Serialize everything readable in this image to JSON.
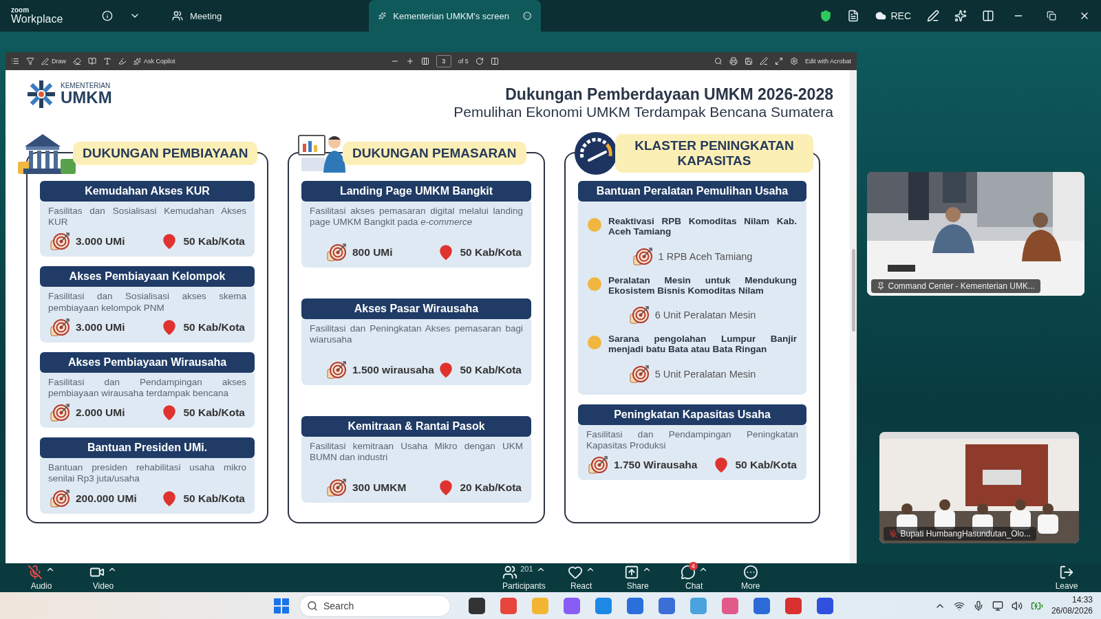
{
  "window": {
    "brand_top": "zoom",
    "brand": "Workplace",
    "tabs": [
      {
        "label": "Meeting",
        "selected": false
      },
      {
        "label": "Kementerian UMKM's screen",
        "selected": true
      }
    ],
    "rec": "REC"
  },
  "pdf_toolbar": {
    "draw": "Draw",
    "copilot": "Ask Copilot",
    "page": "3",
    "page_total": "of 5",
    "edit": "Edit with Acrobat"
  },
  "slide": {
    "logo_small": "KEMENTERIAN",
    "logo_big": "UMKM",
    "title": "Dukungan Pemberdayaan UMKM 2026-2028",
    "subtitle": "Pemulihan Ekonomi UMKM Terdampak Bencana Sumatera",
    "columns": [
      {
        "kind": "bank",
        "heading": "DUKUNGAN PEMBIAYAAN",
        "cards": [
          {
            "kind": "stats",
            "title": "Kemudahan Akses KUR",
            "description": "Fasilitas dan Sosialisasi Kemudahan Akses KUR",
            "target": "3.000 UMi",
            "area": "50 Kab/Kota"
          },
          {
            "kind": "stats",
            "title": "Akses Pembiayaan Kelompok",
            "description": "Fasilitasi dan Sosialisasi akses skema pembiayaan kelompok PNM",
            "target": "3.000 UMi",
            "area": "50 Kab/Kota"
          },
          {
            "kind": "stats",
            "title": "Akses Pembiayaan Wirausaha",
            "description": "Fasilitasi dan Pendampingan akses pembiayaan wirausaha terdampak bencana",
            "target": "2.000 UMi",
            "area": "50 Kab/Kota"
          },
          {
            "kind": "stats",
            "title": "Bantuan Presiden UMi.",
            "description": "Bantuan presiden rehabilitasi usaha mikro senilai Rp3 juta/usaha",
            "target": "200.000 UMi",
            "area": "50 Kab/Kota"
          }
        ]
      },
      {
        "kind": "presenter",
        "heading": "DUKUNGAN PEMASARAN",
        "cards": [
          {
            "kind": "stats",
            "title": "Landing Page UMKM Bangkit",
            "description": "Fasilitasi akses pemasaran digital melalui landing page UMKM Bangkit pada *e-commerce*",
            "target": "800 UMi",
            "area": "50 Kab/Kota"
          },
          {
            "kind": "stats",
            "title": "Akses Pasar Wirausaha",
            "description": "Fasilitasi dan Peningkatan Akses pemasaran bagi wiarusaha",
            "target": "1.500 wirausaha",
            "area": "50 Kab/Kota"
          },
          {
            "kind": "stats",
            "title": "Kemitraan & Rantai Pasok",
            "description": "Fasilitasi kemitraan Usaha Mikro dengan UKM BUMN dan industri",
            "target": "300 UMKM",
            "area": "20 Kab/Kota"
          }
        ]
      },
      {
        "kind": "gauge",
        "heading": "KLASTER PENINGKATAN KAPASITAS",
        "cards": [
          {
            "kind": "list",
            "title": "Bantuan Peralatan Pemulihan Usaha",
            "items": [
              {
                "text": "Reaktivasi RPB Komoditas Nilam Kab. Aceh Tamiang",
                "target": "1 RPB Aceh Tamiang"
              },
              {
                "text": "Peralatan Mesin untuk Mendukung Ekosistem Bisnis Komoditas Nilam",
                "target": "6 Unit Peralatan Mesin"
              },
              {
                "text": "Sarana pengolahan Lumpur Banjir menjadi batu Bata atau Bata Ringan",
                "target": "5 Unit Peralatan Mesin"
              }
            ]
          },
          {
            "kind": "stats",
            "title": "Peningkatan Kapasitas Usaha",
            "description": "Fasilitasi dan Pendampingan Peningkatan Kapasitas Produksi",
            "target": "1.750 Wirausaha",
            "area": "50 Kab/Kota"
          }
        ]
      }
    ]
  },
  "videos": [
    {
      "kind": "pinned",
      "name": "Command Center - Kementerian UMK..."
    },
    {
      "kind": "muted",
      "name": "Bupati HumbangHasundutan_Olo..."
    }
  ],
  "controls": [
    {
      "kind": "audio",
      "label": "Audio",
      "muted": true,
      "caret": true
    },
    {
      "kind": "video",
      "label": "Video",
      "caret": true
    },
    {
      "kind": "participants",
      "label": "Participants",
      "count": "201",
      "caret": true
    },
    {
      "kind": "react",
      "label": "React",
      "caret": true
    },
    {
      "kind": "share",
      "label": "Share",
      "caret": true
    },
    {
      "kind": "chat",
      "label": "Chat",
      "badge": "4",
      "caret": true
    },
    {
      "kind": "more",
      "label": "More",
      "caret": false
    }
  ],
  "leave": "Leave",
  "taskbar": {
    "search_placeholder": "Search",
    "time": "14:33",
    "date": "26/08/2026"
  }
}
